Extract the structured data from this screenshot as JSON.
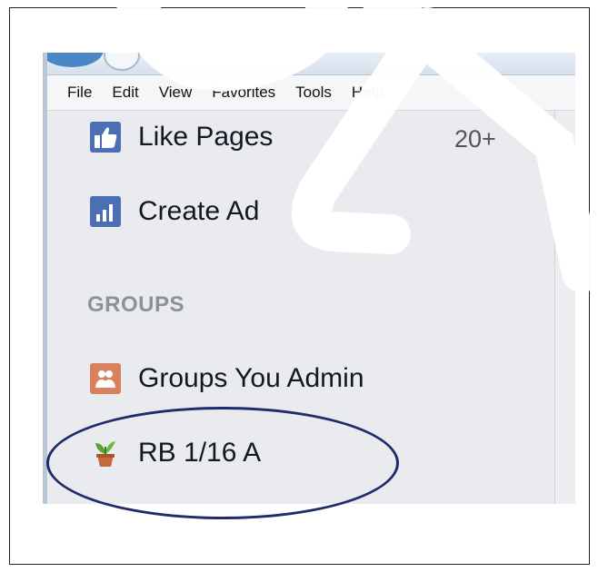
{
  "menubar": {
    "items": [
      "File",
      "Edit",
      "View",
      "Favorites",
      "Tools",
      "Help"
    ]
  },
  "sidebar": {
    "like_pages": {
      "label": "Like Pages",
      "count": "20+",
      "icon": "thumbs-up-icon"
    },
    "create_ad": {
      "label": "Create Ad",
      "icon": "bar-chart-icon"
    },
    "groups_header": "GROUPS",
    "groups_you_admin": {
      "label": "Groups You Admin",
      "icon": "group-admin-icon"
    },
    "group_item": {
      "label": "RB 1/16 A",
      "icon": "potted-plant-icon"
    }
  },
  "colors": {
    "facebook_blue": "#4b6fb4",
    "admin_orange": "#d9805c",
    "annotation_ellipse": "#1f2b6b"
  }
}
